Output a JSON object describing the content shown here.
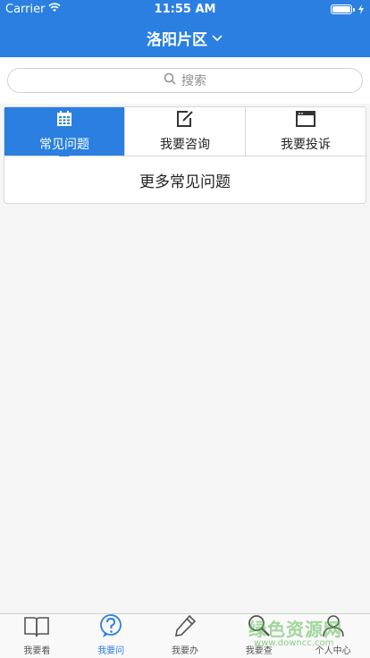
{
  "status": {
    "carrier": "Carrier",
    "time": "11:55 AM",
    "battery_level": 1.0
  },
  "nav": {
    "title": "洛阳片区"
  },
  "search": {
    "placeholder": "搜索"
  },
  "tabs": [
    {
      "label": "常见问题",
      "icon": "calendar-grid-icon",
      "active": true
    },
    {
      "label": "我要咨询",
      "icon": "edit-icon",
      "active": false
    },
    {
      "label": "我要投诉",
      "icon": "browser-window-icon",
      "active": false
    }
  ],
  "more": {
    "label": "更多常见问题"
  },
  "tabbar": [
    {
      "label": "我要看",
      "icon": "book-icon",
      "active": false
    },
    {
      "label": "我要问",
      "icon": "question-icon",
      "active": true
    },
    {
      "label": "我要办",
      "icon": "pencil-icon",
      "active": false
    },
    {
      "label": "我要查",
      "icon": "magnifier-icon",
      "active": false
    },
    {
      "label": "个人中心",
      "icon": "person-icon",
      "active": false
    }
  ],
  "watermark": {
    "text": "绿色资源网",
    "url": "www.downcc.com"
  },
  "colors": {
    "accent": "#2a7fe0",
    "watermark": "#5ab950"
  }
}
